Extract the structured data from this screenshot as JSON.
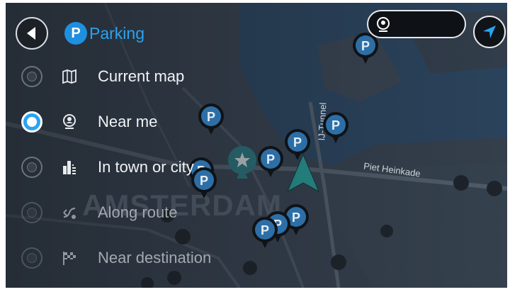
{
  "header": {
    "title": "Parking",
    "poi_badge": "P"
  },
  "options": [
    {
      "label": "Current map",
      "icon": "map-icon",
      "selected": false,
      "enabled": true
    },
    {
      "label": "Near me",
      "icon": "person-location-icon",
      "selected": true,
      "enabled": true
    },
    {
      "label": "In town or city",
      "icon": "city-icon",
      "selected": false,
      "enabled": true
    },
    {
      "label": "Along route",
      "icon": "route-icon",
      "selected": false,
      "enabled": false
    },
    {
      "label": "Near destination",
      "icon": "checkered-flag-icon",
      "selected": false,
      "enabled": false
    }
  ],
  "map": {
    "city_label": "AMSTERDAM",
    "street_1": "Piet Heinkade",
    "street_2": "IJ-Tunnel",
    "pin_letter": "P"
  },
  "colors": {
    "accent": "#2aa3f0",
    "pin_blue": "#2d6ea6",
    "background": "#2a3440"
  }
}
